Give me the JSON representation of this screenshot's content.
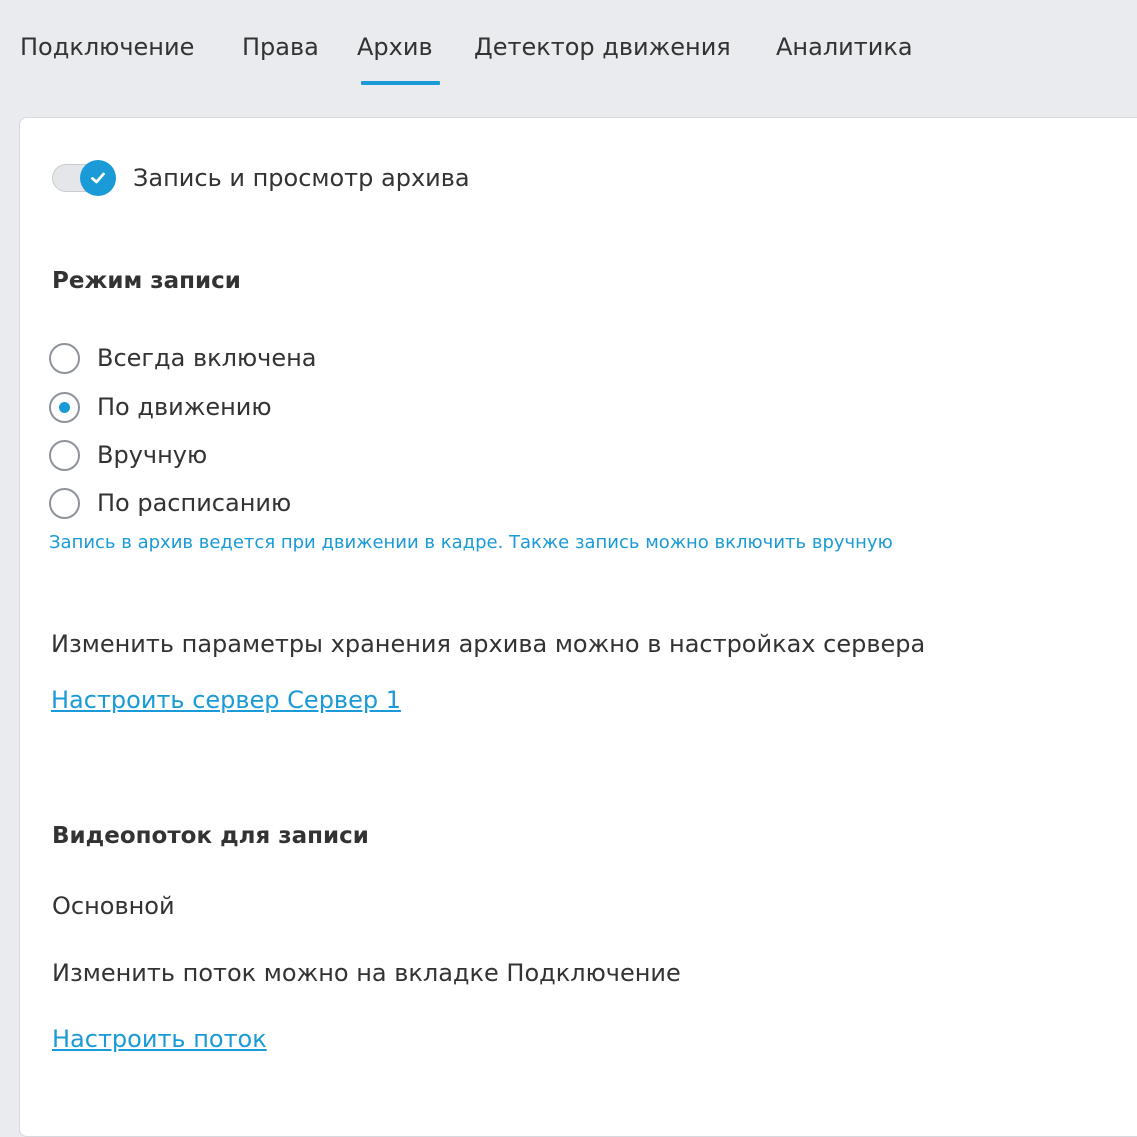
{
  "tabs": [
    {
      "label": "Подключение",
      "active": false
    },
    {
      "label": "Права",
      "active": false
    },
    {
      "label": "Архив",
      "active": true
    },
    {
      "label": "Детектор движения",
      "active": false
    },
    {
      "label": "Аналитика",
      "active": false
    }
  ],
  "archive_toggle": {
    "label": "Запись и просмотр архива",
    "enabled": true,
    "icon": "check-icon"
  },
  "record_mode": {
    "title": "Режим записи",
    "options": [
      {
        "label": "Всегда включена",
        "selected": false
      },
      {
        "label": "По движению",
        "selected": true
      },
      {
        "label": "Вручную",
        "selected": false
      },
      {
        "label": "По расписанию",
        "selected": false
      }
    ],
    "hint": "Запись в архив ведется при движении в кадре. Также запись можно включить вручную"
  },
  "storage": {
    "text": "Изменить параметры хранения архива можно в настройках сервера",
    "link": "Настроить сервер Сервер 1"
  },
  "stream": {
    "title": "Видеопоток для записи",
    "value": "Основной",
    "text": "Изменить поток можно на вкладке Подключение",
    "link": "Настроить поток"
  },
  "colors": {
    "accent": "#1a9ad6",
    "background": "#e9ebef",
    "panel": "#ffffff",
    "text": "#333333"
  }
}
